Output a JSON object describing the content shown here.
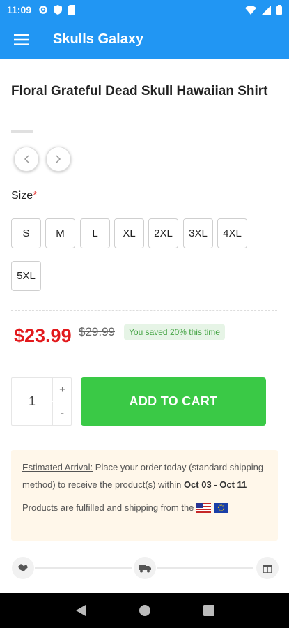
{
  "status_bar": {
    "time": "11:09"
  },
  "app_bar": {
    "title": "Skulls Galaxy"
  },
  "product": {
    "title": "Floral Grateful Dead Skull Hawaiian Shirt",
    "size_label": "Size",
    "size_required_marker": "*",
    "sizes": [
      "S",
      "M",
      "L",
      "XL",
      "2XL",
      "3XL",
      "4XL",
      "5XL"
    ],
    "price": "$23.99",
    "old_price": "$29.99",
    "saved_text": "You saved 20% this time"
  },
  "cart": {
    "quantity": "1",
    "plus_label": "+",
    "minus_label": "-",
    "add_to_cart_label": "ADD TO CART"
  },
  "shipping": {
    "estimated_label": "Estimated Arrival:",
    "estimated_text": " Place your order today (standard shipping method) to receive the product(s) within ",
    "date_range": "Oct 03 - Oct 11",
    "fulfilled_text": "Products are fulfilled and shipping from the"
  },
  "colors": {
    "primary": "#2196f3",
    "price_red": "#e2191c",
    "cart_green": "#3ac946",
    "saved_green": "#46a546"
  }
}
